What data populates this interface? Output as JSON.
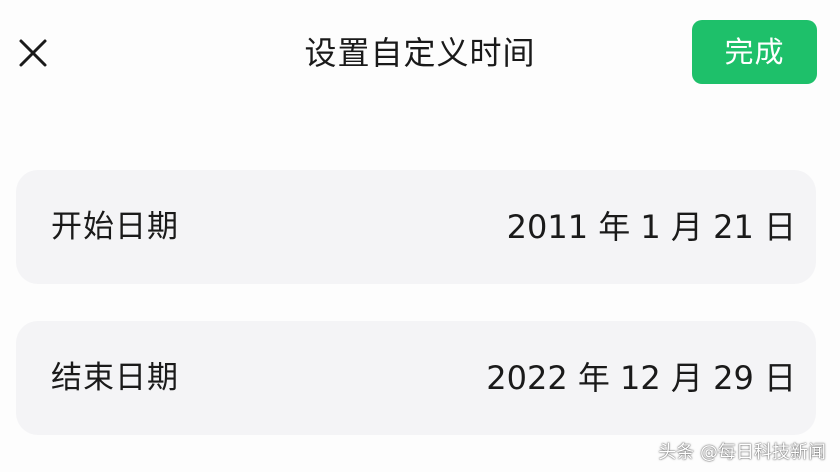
{
  "header": {
    "close_icon": "close-icon",
    "title": "设置自定义时间",
    "done_label": "完成"
  },
  "rows": [
    {
      "label": "开始日期",
      "value": "2011 年 1 月 21 日"
    },
    {
      "label": "结束日期",
      "value": "2022 年 12 月 29 日"
    }
  ],
  "watermark": "头条 @每日科技新闻",
  "colors": {
    "accent": "#1ec06a",
    "background": "#fdfdfd",
    "row_background": "#f4f4f6"
  }
}
